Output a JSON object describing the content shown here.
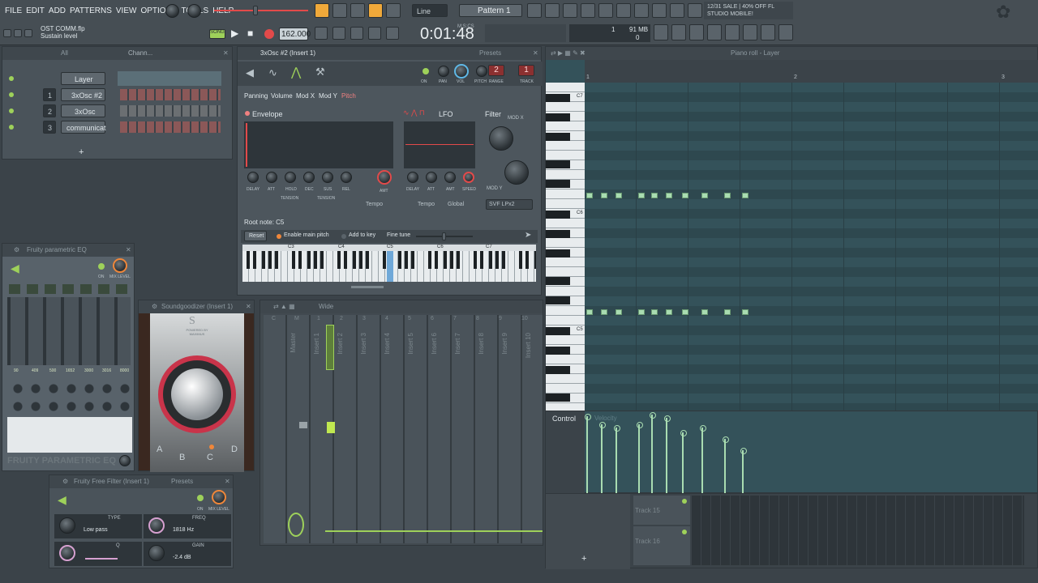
{
  "menubar": {
    "items": [
      "FILE",
      "EDIT",
      "ADD",
      "PATTERNS",
      "VIEW",
      "OPTIONS",
      "TOOLS",
      "HELP"
    ]
  },
  "toolbar": {
    "pattern": "Pattern 1",
    "snap": "Line",
    "tempo": "162.000",
    "time": "0:01:48",
    "time_label": "M:S:CS",
    "hint_file": "OST COMM.flp",
    "hint_text": "Sustain level",
    "song_label": "SONG",
    "news_line1": "12/31  SALE | 40% OFF FL",
    "news_line2": "STUDIO MOBILE!",
    "cpu": "1",
    "mem": "91 MB",
    "mem2": "0"
  },
  "channel_rack": {
    "title": "Chann...",
    "filter": "All",
    "channels": [
      {
        "num": "",
        "name": "Layer"
      },
      {
        "num": "1",
        "name": "3xOsc #2"
      },
      {
        "num": "2",
        "name": "3xOsc"
      },
      {
        "num": "3",
        "name": "communicat"
      }
    ],
    "add": "+"
  },
  "osc": {
    "title": "3xOsc #2 (Insert 1)",
    "presets": "Presets",
    "tabs": [
      "Panning",
      "Volume",
      "Mod X",
      "Mod Y",
      "Pitch"
    ],
    "envelope": "Envelope",
    "lfo": "LFO",
    "filter": "Filter",
    "modx": "MOD X",
    "mody": "MOD Y",
    "env_knobs": [
      "DELAY",
      "ATT",
      "HOLD",
      "DEC",
      "SUS",
      "REL"
    ],
    "amt": "AMT",
    "tension": "TENSION",
    "lfo_knobs": [
      "DELAY",
      "ATT",
      "AMT",
      "SPEED"
    ],
    "tempo": "Tempo",
    "global": "Global",
    "filter_type": "SVF LPx2",
    "root_note": "Root note: C5",
    "reset": "Reset",
    "enable_pitch": "Enable main pitch",
    "add_key": "Add to key",
    "fine_tune": "Fine tune",
    "top_labels": [
      "ON",
      "PAN",
      "VOL",
      "PITCH",
      "RANGE",
      "TRACK"
    ],
    "pitch_range": "2",
    "track": "1",
    "octaves": [
      "C3",
      "C4",
      "C5",
      "C6",
      "C7"
    ]
  },
  "eq": {
    "title": "Fruity parametric EQ",
    "on": "ON",
    "mix": "MIX LEVEL",
    "freqs": [
      "90",
      "409",
      "500",
      "1652",
      "3000",
      "3016",
      "8000"
    ],
    "brand": "FRUITY PARAMETRIC EQ"
  },
  "soundgoodizer": {
    "title": "Soundgoodizer (Insert 1)",
    "modes": [
      "A",
      "B",
      "C",
      "D"
    ],
    "powered": "POWERED BY MAXIMUS"
  },
  "filter": {
    "title": "Fruity Free Filter (Insert 1)",
    "presets": "Presets",
    "type_label": "TYPE",
    "type": "Low pass",
    "freq_label": "FREQ",
    "freq": "1818 Hz",
    "q_label": "Q",
    "gain_label": "GAIN",
    "gain": "-2.4 dB",
    "on": "ON",
    "mix": "MIX LEVEL"
  },
  "mixer": {
    "title": "Wide",
    "tracks": [
      "Master",
      "Insert 1",
      "Insert 2",
      "Insert 3",
      "Insert 4",
      "Insert 5",
      "Insert 6",
      "Insert 7",
      "Insert 8",
      "Insert 9",
      "Insert 10"
    ],
    "nums": [
      "C",
      "M",
      "1",
      "2",
      "3",
      "4",
      "5",
      "6",
      "7",
      "8",
      "9",
      "10"
    ]
  },
  "pianoroll": {
    "title": "Piano roll - Layer",
    "octaves": [
      "C7",
      "C6",
      "C5"
    ],
    "bars": [
      "1",
      "2",
      "3"
    ],
    "control": "Control",
    "velocity": "Velocity",
    "tracks": [
      "Track 15",
      "Track 16"
    ],
    "add": "+"
  },
  "colors": {
    "accent": "#f0873a",
    "green": "#a9dcb1",
    "led": "#9ed15a",
    "red": "#e24a4a"
  }
}
